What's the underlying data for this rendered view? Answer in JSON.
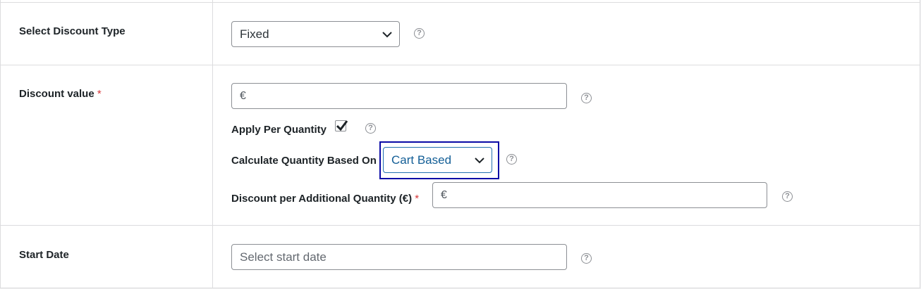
{
  "rows": {
    "discount_type": {
      "label": "Select Discount Type",
      "selected": "Fixed"
    },
    "discount_value": {
      "label": "Discount value",
      "required_mark": "*",
      "value_prefix": "€",
      "apply_per_quantity_label": "Apply Per Quantity",
      "apply_per_quantity_checked": true,
      "calc_quantity_label": "Calculate Quantity Based On",
      "calc_quantity_selected": "Cart Based",
      "additional_quantity_label": "Discount per Additional Quantity (€)",
      "additional_required_mark": "*",
      "additional_prefix": "€"
    },
    "start_date": {
      "label": "Start Date",
      "placeholder": "Select start date"
    }
  },
  "help_icon_glyph": "?",
  "colors": {
    "required": "#d63638",
    "focus_outline": "#0a0aa6",
    "select_focus": "#2271b1"
  }
}
